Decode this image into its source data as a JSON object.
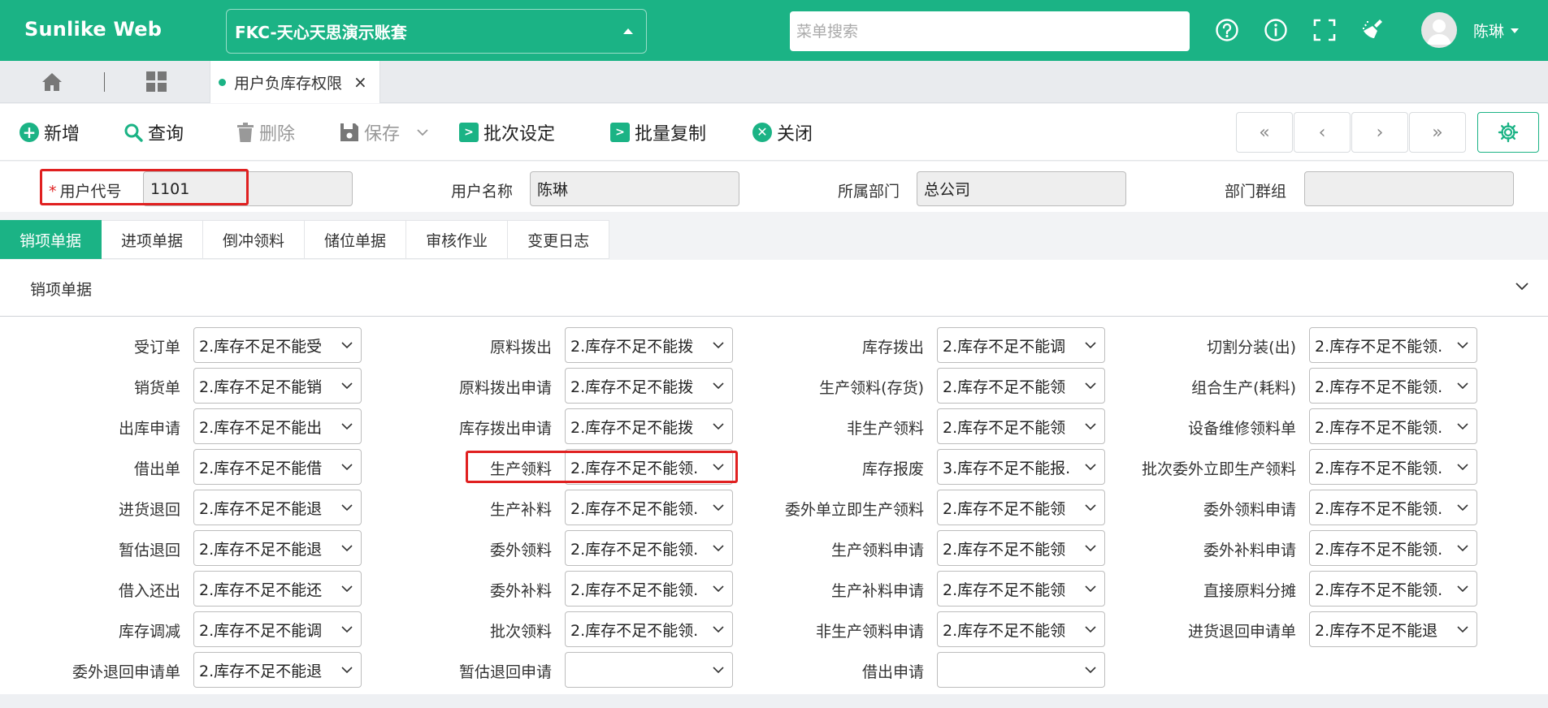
{
  "header": {
    "logo": "Sunlike Web",
    "account": "FKC-天心天思演示账套",
    "search_placeholder": "菜单搜索",
    "user_name": "陈琳"
  },
  "tabs": {
    "doc_tab_label": "用户负库存权限",
    "close_glyph": "×"
  },
  "toolbar": {
    "add": "新增",
    "query": "查询",
    "delete": "删除",
    "save": "保存",
    "batch_set": "批次设定",
    "batch_copy": "批量复制",
    "close": "关闭"
  },
  "form": {
    "required_mark": "*",
    "user_code_label": "用户代号",
    "user_code_value": "1101",
    "user_name_label": "用户名称",
    "user_name_value": "陈琳",
    "department_label": "所属部门",
    "department_value": "总公司",
    "dept_group_label": "部门群组",
    "dept_group_value": ""
  },
  "section_tabs": [
    "销项单据",
    "进项单据",
    "倒冲领料",
    "储位单据",
    "审核作业",
    "变更日志"
  ],
  "panel": {
    "title": "销项单据",
    "columns": [
      [
        {
          "label": "受订单",
          "value": "2.库存不足不能受"
        },
        {
          "label": "销货单",
          "value": "2.库存不足不能销"
        },
        {
          "label": "出库申请",
          "value": "2.库存不足不能出"
        },
        {
          "label": "借出单",
          "value": "2.库存不足不能借"
        },
        {
          "label": "进货退回",
          "value": "2.库存不足不能退"
        },
        {
          "label": "暂估退回",
          "value": "2.库存不足不能退"
        },
        {
          "label": "借入还出",
          "value": "2.库存不足不能还"
        },
        {
          "label": "库存调减",
          "value": "2.库存不足不能调"
        },
        {
          "label": "委外退回申请单",
          "value": "2.库存不足不能退"
        }
      ],
      [
        {
          "label": "原料拨出",
          "value": "2.库存不足不能拨"
        },
        {
          "label": "原料拨出申请",
          "value": "2.库存不足不能拨"
        },
        {
          "label": "库存拨出申请",
          "value": "2.库存不足不能拨"
        },
        {
          "label": "生产领料",
          "value": "2.库存不足不能领."
        },
        {
          "label": "生产补料",
          "value": "2.库存不足不能领."
        },
        {
          "label": "委外领料",
          "value": "2.库存不足不能领."
        },
        {
          "label": "委外补料",
          "value": "2.库存不足不能领."
        },
        {
          "label": "批次领料",
          "value": "2.库存不足不能领."
        },
        {
          "label": "暂估退回申请",
          "value": ""
        }
      ],
      [
        {
          "label": "库存拨出",
          "value": "2.库存不足不能调"
        },
        {
          "label": "生产领料(存货)",
          "value": "2.库存不足不能领"
        },
        {
          "label": "非生产领料",
          "value": "2.库存不足不能领"
        },
        {
          "label": "库存报废",
          "value": "3.库存不足不能报."
        },
        {
          "label": "委外单立即生产领料",
          "value": "2.库存不足不能领"
        },
        {
          "label": "生产领料申请",
          "value": "2.库存不足不能领"
        },
        {
          "label": "生产补料申请",
          "value": "2.库存不足不能领"
        },
        {
          "label": "非生产领料申请",
          "value": "2.库存不足不能领"
        },
        {
          "label": "借出申请",
          "value": ""
        }
      ],
      [
        {
          "label": "切割分装(出)",
          "value": "2.库存不足不能领."
        },
        {
          "label": "组合生产(耗料)",
          "value": "2.库存不足不能领."
        },
        {
          "label": "设备维修领料单",
          "value": "2.库存不足不能领."
        },
        {
          "label": "批次委外立即生产领料",
          "value": "2.库存不足不能领."
        },
        {
          "label": "委外领料申请",
          "value": "2.库存不足不能领."
        },
        {
          "label": "委外补料申请",
          "value": "2.库存不足不能领."
        },
        {
          "label": "直接原料分摊",
          "value": "2.库存不足不能领."
        },
        {
          "label": "进货退回申请单",
          "value": "2.库存不足不能退"
        }
      ]
    ]
  },
  "colors": {
    "brand": "#1bb385",
    "highlight": "#e02020"
  }
}
